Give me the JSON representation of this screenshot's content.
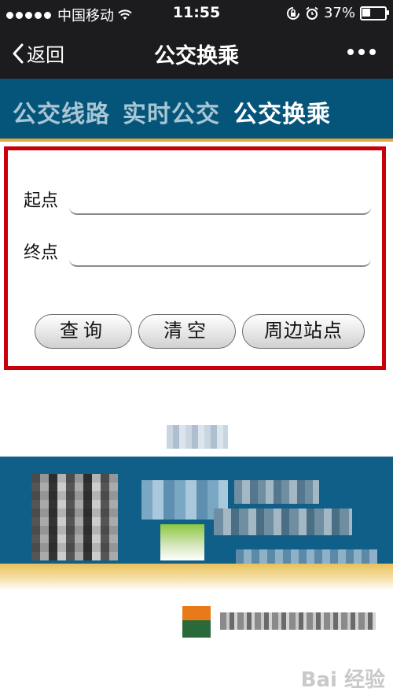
{
  "status_bar": {
    "carrier": "中国移动",
    "time": "11:55",
    "battery": "37%",
    "battery_level": 0.37
  },
  "nav": {
    "back_label": "返回",
    "title": "公交换乘"
  },
  "tabs": [
    {
      "label": "公交线路",
      "active": false
    },
    {
      "label": "实时公交",
      "active": false
    },
    {
      "label": "公交换乘",
      "active": true
    }
  ],
  "form": {
    "start_label": "起点",
    "start_value": "",
    "end_label": "终点",
    "end_value": "",
    "buttons": {
      "query": "查询",
      "clear": "清空",
      "nearby": "周边站点"
    }
  },
  "colors": {
    "tab_bg": "#05557a",
    "highlight_border": "#c8000a",
    "tab_underline": "#e8a83a"
  },
  "watermark": "Bai 经验"
}
